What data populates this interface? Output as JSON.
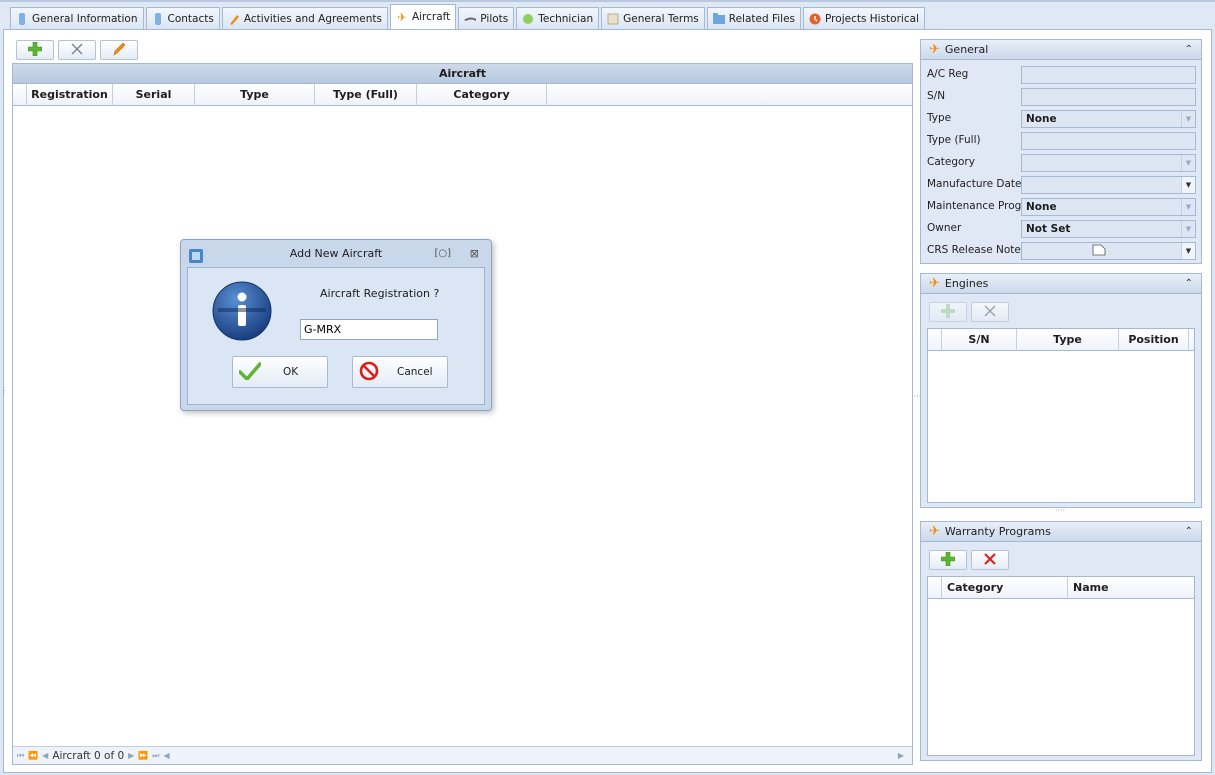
{
  "tabs": [
    {
      "label": "General Information",
      "icon": "info-tab-icon",
      "active": false
    },
    {
      "label": "Contacts",
      "icon": "contacts-tab-icon",
      "active": false
    },
    {
      "label": "Activities and Agreements",
      "icon": "pencil-tab-icon",
      "active": false
    },
    {
      "label": "Aircraft",
      "icon": "airplane-tab-icon",
      "active": true
    },
    {
      "label": "Pilots",
      "icon": "pilots-tab-icon",
      "active": false
    },
    {
      "label": "Technician",
      "icon": "technician-tab-icon",
      "active": false
    },
    {
      "label": "General Terms",
      "icon": "terms-tab-icon",
      "active": false
    },
    {
      "label": "Related Files",
      "icon": "folder-tab-icon",
      "active": false
    },
    {
      "label": "Projects Historical",
      "icon": "history-tab-icon",
      "active": false
    }
  ],
  "aircraft_grid": {
    "title": "Aircraft",
    "columns": [
      "Registration",
      "Serial",
      "Type",
      "Type (Full)",
      "Category"
    ],
    "footer_text": "Aircraft 0 of 0"
  },
  "general": {
    "title": "General",
    "fields": [
      {
        "label": "A/C Reg",
        "value": ""
      },
      {
        "label": "S/N",
        "value": ""
      },
      {
        "label": "Type",
        "value": "None"
      },
      {
        "label": "Type (Full)",
        "value": ""
      },
      {
        "label": "Category",
        "value": ""
      },
      {
        "label": "Manufacture Date",
        "value": ""
      },
      {
        "label": "Maintenance Prog.",
        "value": "None"
      },
      {
        "label": "Owner",
        "value": "Not Set"
      },
      {
        "label": "CRS Release Note",
        "value": ""
      }
    ]
  },
  "engines": {
    "title": "Engines",
    "columns": [
      "S/N",
      "Type",
      "Position"
    ]
  },
  "warranty": {
    "title": "Warranty Programs",
    "columns": [
      "Category",
      "Name"
    ]
  },
  "dialog": {
    "title": "Add New Aircraft",
    "prompt": "Aircraft Registration ?",
    "input_value": "G-MRX",
    "ok_label": "OK",
    "cancel_label": "Cancel"
  },
  "colors": {
    "accent_orange": "#f08c1c",
    "add_green": "#5db533",
    "delete_red": "#d8201b",
    "panel_bg": "#dfe8f4",
    "info_blue": "#1f4f96"
  }
}
